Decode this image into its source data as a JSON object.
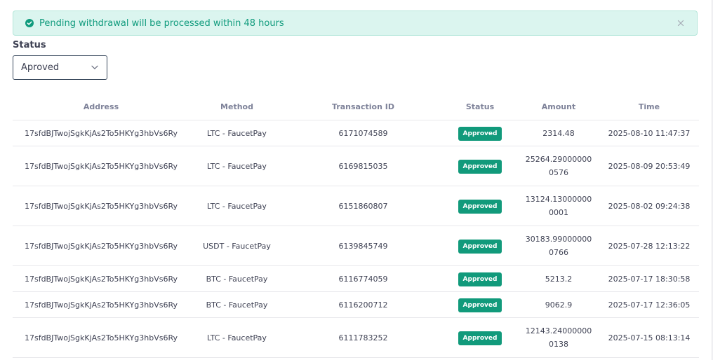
{
  "alert": {
    "message": "Pending withdrawal will be processed within 48 hours",
    "icon": "check-circle-icon",
    "close_icon": "close-icon",
    "color": "#109b7d",
    "background": "#dbf5ef"
  },
  "filter": {
    "label": "Status",
    "selected": "Aproved"
  },
  "table": {
    "headers": {
      "address": "Address",
      "method": "Method",
      "txid": "Transaction ID",
      "status": "Status",
      "amount": "Amount",
      "time": "Time"
    },
    "badge_color": "#119a7b",
    "rows": [
      {
        "address": "17sfdBJTwojSgkKjAs2To5HKYg3hbVs6Ry",
        "method": "LTC - FaucetPay",
        "txid": "6171074589",
        "status": "Approved",
        "amount": "2314.48",
        "time": "2025-08-10 11:47:37"
      },
      {
        "address": "17sfdBJTwojSgkKjAs2To5HKYg3hbVs6Ry",
        "method": "LTC - FaucetPay",
        "txid": "6169815035",
        "status": "Approved",
        "amount": "25264.290000000576",
        "time": "2025-08-09 20:53:49"
      },
      {
        "address": "17sfdBJTwojSgkKjAs2To5HKYg3hbVs6Ry",
        "method": "LTC - FaucetPay",
        "txid": "6151860807",
        "status": "Approved",
        "amount": "13124.130000000001",
        "time": "2025-08-02 09:24:38"
      },
      {
        "address": "17sfdBJTwojSgkKjAs2To5HKYg3hbVs6Ry",
        "method": "USDT - FaucetPay",
        "txid": "6139845749",
        "status": "Approved",
        "amount": "30183.990000000766",
        "time": "2025-07-28 12:13:22"
      },
      {
        "address": "17sfdBJTwojSgkKjAs2To5HKYg3hbVs6Ry",
        "method": "BTC - FaucetPay",
        "txid": "6116774059",
        "status": "Approved",
        "amount": "5213.2",
        "time": "2025-07-17 18:30:58"
      },
      {
        "address": "17sfdBJTwojSgkKjAs2To5HKYg3hbVs6Ry",
        "method": "BTC - FaucetPay",
        "txid": "6116200712",
        "status": "Approved",
        "amount": "9062.9",
        "time": "2025-07-17 12:36:05"
      },
      {
        "address": "17sfdBJTwojSgkKjAs2To5HKYg3hbVs6Ry",
        "method": "LTC - FaucetPay",
        "txid": "6111783252",
        "status": "Approved",
        "amount": "12143.240000000138",
        "time": "2025-07-15 08:13:14"
      }
    ]
  }
}
